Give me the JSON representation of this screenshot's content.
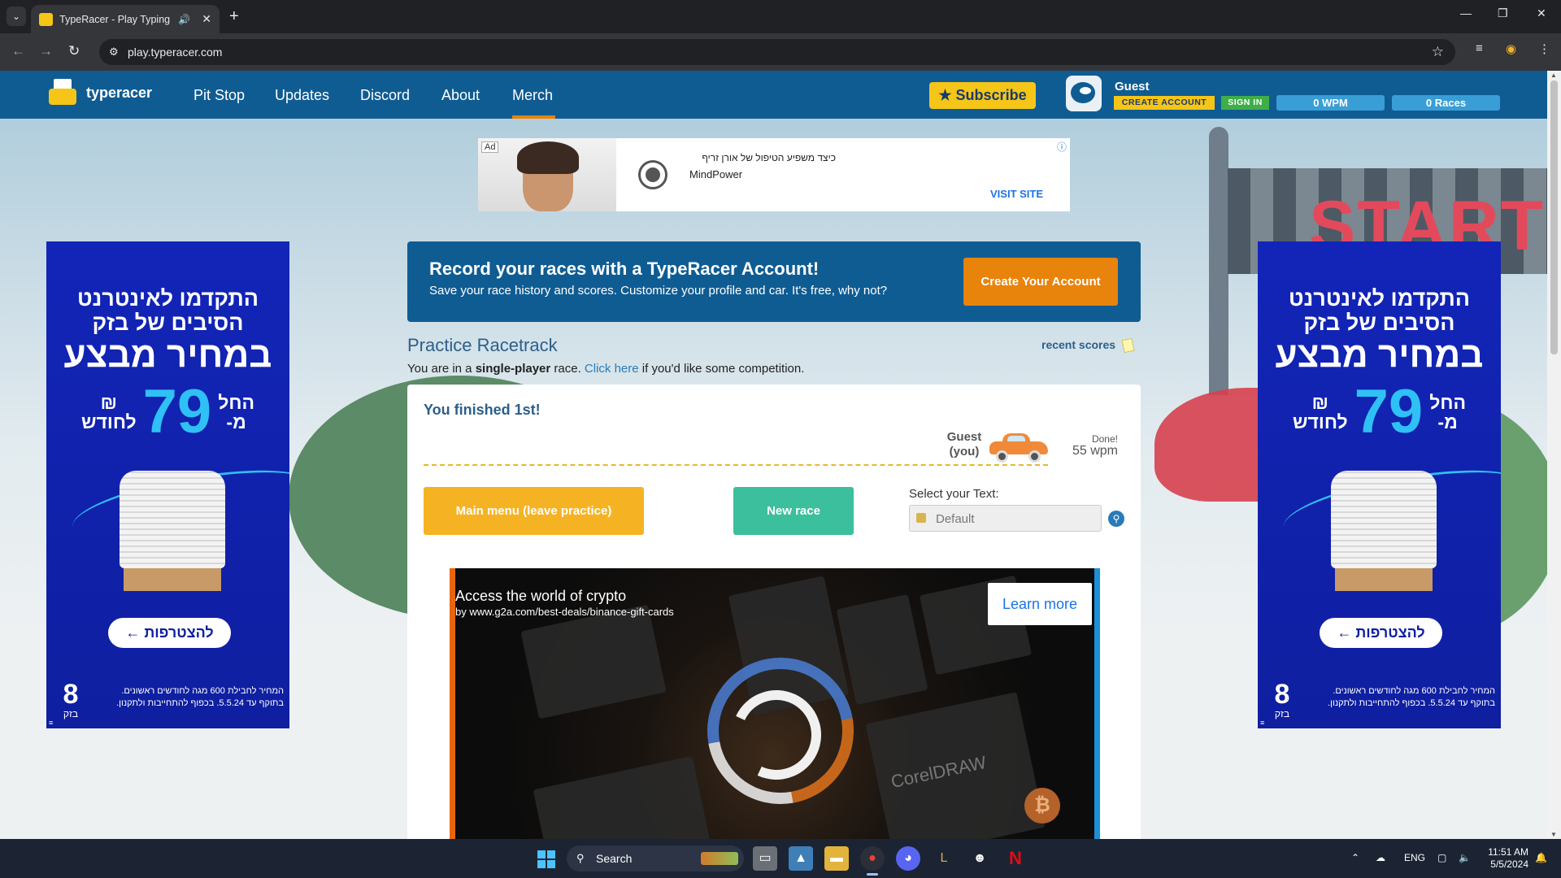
{
  "browser": {
    "tab_title": "TypeRacer - Play Typing Ga",
    "url": "play.typeracer.com"
  },
  "header": {
    "logo_text": "typeracer",
    "nav": [
      "Pit Stop",
      "Updates",
      "Discord",
      "About",
      "Merch"
    ],
    "subscribe_label": "★ Subscribe",
    "guest_name": "Guest",
    "create_account": "CREATE ACCOUNT",
    "sign_in": "SIGN IN",
    "wpm": "0  WPM",
    "races": "0 Races"
  },
  "top_ad": {
    "ad_label": "Ad",
    "title": "כיצד משפיע הטיפול של אורן זריף",
    "brand": "MindPower",
    "cta": "VISIT SITE",
    "info": "ⓘ"
  },
  "side_ad": {
    "line1": "התקדמו לאינטרנט",
    "line2": "הסיבים של בזק",
    "line3": "במחיר מבצע",
    "from": "החל\nמ-",
    "price": "79",
    "per": "₪\nלחודש",
    "cta": "להצטרפות ←",
    "logo_mark": "8",
    "logo_name": "בזק",
    "fine_print": "המחיר לחבילת 600 מגה לחודשים ראשונים. בתוקף עד 5.5.24. בכפוף להתחייבות ולתקנון."
  },
  "promo": {
    "title": "Record your races with a TypeRacer Account!",
    "subtitle": "Save your race history and scores. Customize your profile and car. It's free, why not?",
    "button": "Create Your Account"
  },
  "practice": {
    "title": "Practice Racetrack",
    "recent_scores": "recent scores",
    "desc_pre": "You are in a ",
    "desc_bold": "single-player",
    "desc_mid": " race. ",
    "desc_link": "Click here",
    "desc_post": " if you'd like some competition."
  },
  "race": {
    "finished": "You finished 1st!",
    "racer_name": "Guest",
    "racer_you": "(you)",
    "done": "Done!",
    "wpm": "55 wpm",
    "main_menu": "Main menu (leave practice)",
    "new_race": "New race",
    "select_label": "Select your Text:",
    "select_value": "Default"
  },
  "crypto_ad": {
    "headline": "Access the world of crypto",
    "byline": "by www.g2a.com/best-deals/binance-gift-cards",
    "cta": "Learn more",
    "tile_text": "CorelDRAW"
  },
  "taskbar": {
    "search_placeholder": "Search",
    "lang": "ENG",
    "time": "11:51 AM",
    "date": "5/5/2024"
  },
  "colors": {
    "header_blue": "#0f5c93",
    "accent_orange": "#e8830b",
    "subscribe_yellow": "#f5c518",
    "menu_button": "#f5b324",
    "new_race_button": "#3cbf9c",
    "ad_blue": "#1225b8"
  }
}
